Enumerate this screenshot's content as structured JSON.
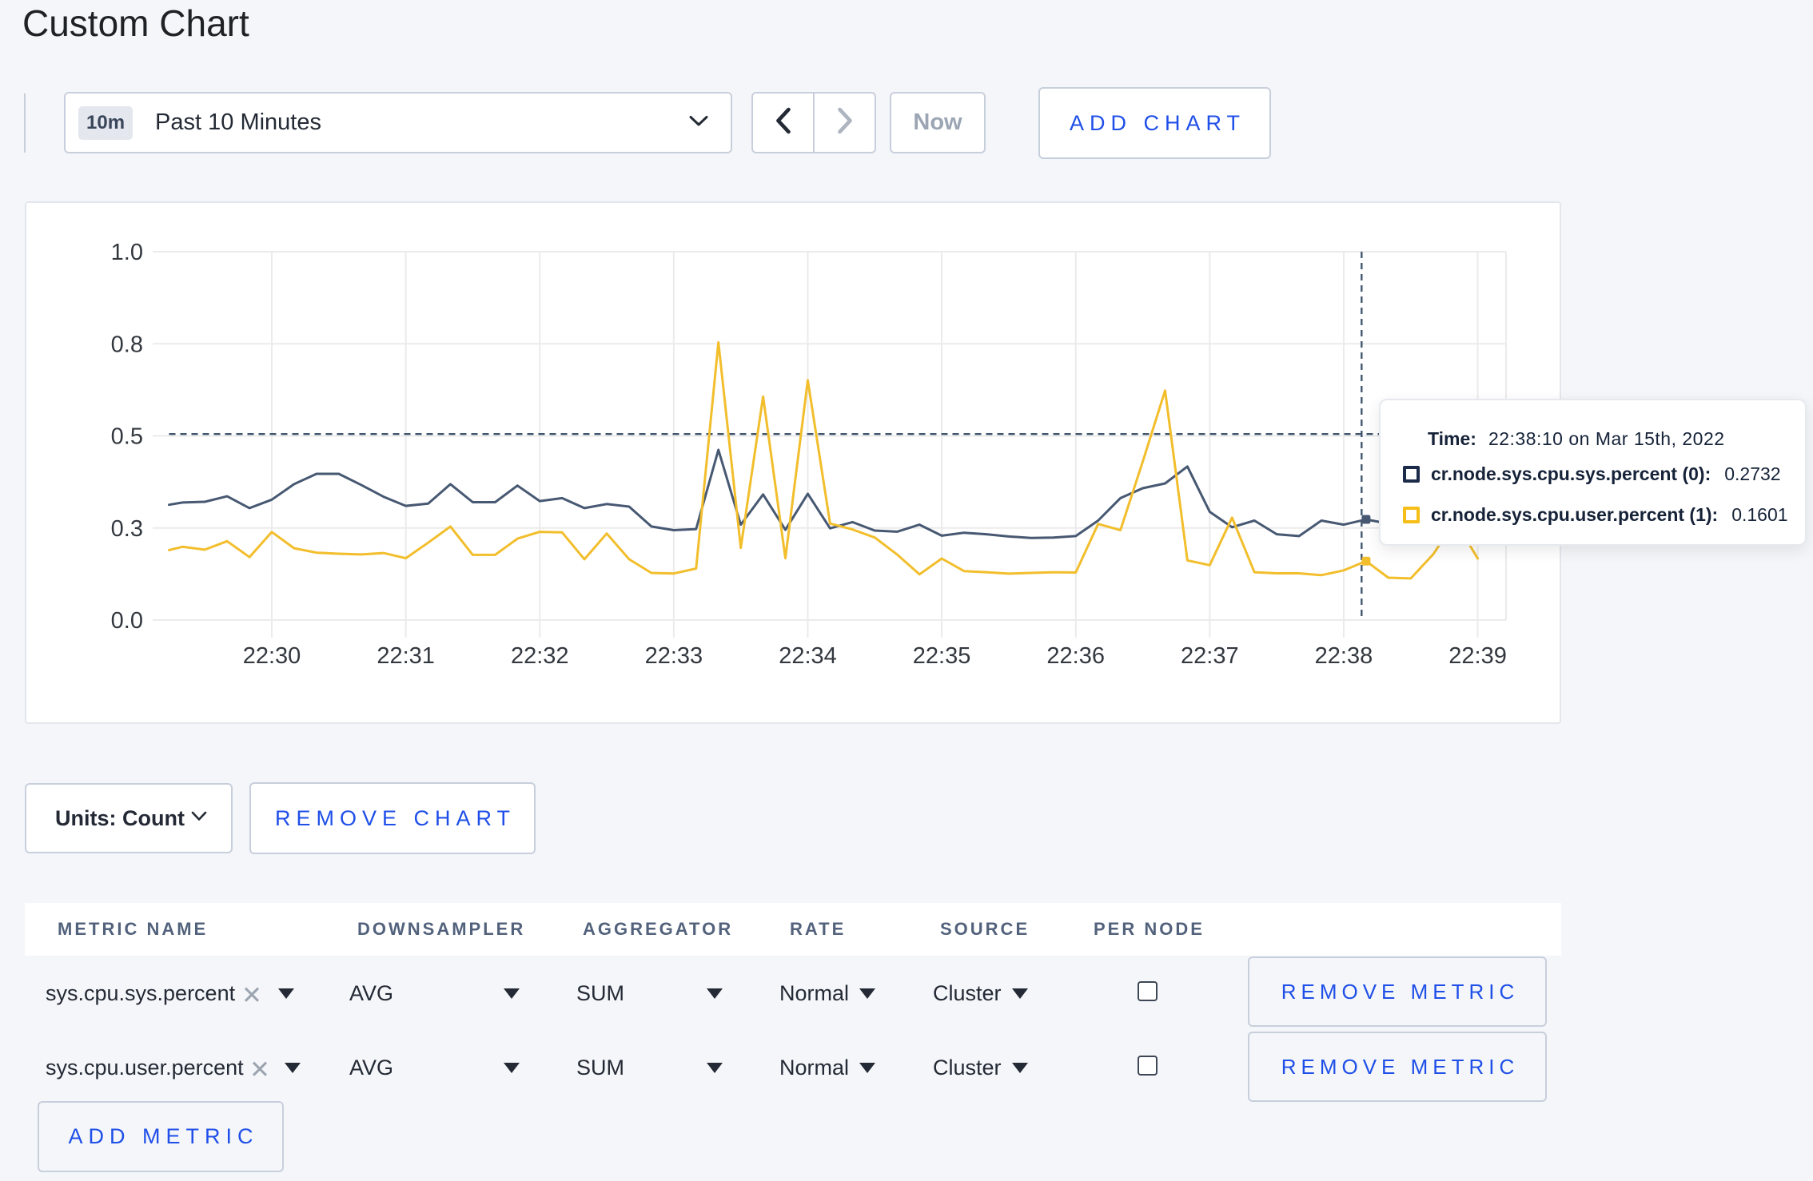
{
  "page": {
    "title": "Custom Chart"
  },
  "controls": {
    "time_window_badge": "10m",
    "time_window_label": "Past 10 Minutes",
    "now_label": "Now",
    "add_chart_label": "ADD CHART"
  },
  "chart_data": {
    "type": "line",
    "title": "",
    "xlabel": "",
    "ylabel": "",
    "x_tick_labels": [
      "22:30",
      "22:31",
      "22:32",
      "22:33",
      "22:34",
      "22:35",
      "22:36",
      "22:37",
      "22:38",
      "22:39"
    ],
    "y_ticks": {
      "values": [
        0,
        0.25,
        0.5,
        0.75,
        1.0
      ],
      "labels": [
        "0.0",
        "0.3",
        "0.5",
        "0.8",
        "1.0"
      ]
    },
    "ylim": [
      0,
      1
    ],
    "grid": true,
    "times": [
      "22:29:14",
      "22:29:20",
      "22:29:30",
      "22:29:40",
      "22:29:50",
      "22:30:00",
      "22:30:10",
      "22:30:20",
      "22:30:30",
      "22:30:40",
      "22:30:50",
      "22:31:00",
      "22:31:10",
      "22:31:20",
      "22:31:30",
      "22:31:40",
      "22:31:50",
      "22:32:00",
      "22:32:10",
      "22:32:20",
      "22:32:30",
      "22:32:40",
      "22:32:50",
      "22:33:00",
      "22:33:10",
      "22:33:20",
      "22:33:30",
      "22:33:40",
      "22:33:50",
      "22:34:00",
      "22:34:10",
      "22:34:20",
      "22:34:30",
      "22:34:40",
      "22:34:50",
      "22:35:00",
      "22:35:10",
      "22:35:20",
      "22:35:30",
      "22:35:40",
      "22:35:50",
      "22:36:00",
      "22:36:10",
      "22:36:20",
      "22:36:30",
      "22:36:40",
      "22:36:50",
      "22:37:00",
      "22:37:10",
      "22:37:20",
      "22:37:30",
      "22:37:40",
      "22:37:50",
      "22:38:00",
      "22:38:10",
      "22:38:20",
      "22:38:30",
      "22:38:40",
      "22:38:50",
      "22:39:00"
    ],
    "series": [
      {
        "name": "cr.node.sys.cpu.sys.percent (0)",
        "color": "#475872",
        "hover_value": "0.2732",
        "values": [
          0.313,
          0.319,
          0.321,
          0.336,
          0.304,
          0.327,
          0.369,
          0.397,
          0.397,
          0.367,
          0.335,
          0.31,
          0.316,
          0.369,
          0.32,
          0.32,
          0.365,
          0.323,
          0.331,
          0.304,
          0.315,
          0.308,
          0.254,
          0.244,
          0.247,
          0.462,
          0.259,
          0.341,
          0.245,
          0.343,
          0.249,
          0.266,
          0.243,
          0.24,
          0.259,
          0.229,
          0.237,
          0.233,
          0.227,
          0.223,
          0.224,
          0.228,
          0.27,
          0.331,
          0.358,
          0.371,
          0.417,
          0.294,
          0.252,
          0.27,
          0.233,
          0.228,
          0.27,
          0.259,
          0.2732,
          0.262,
          0.258,
          0.268,
          0.272,
          0.265
        ]
      },
      {
        "name": "cr.node.sys.cpu.user.percent (1)",
        "color": "#F2BE2C",
        "hover_value": "0.1601",
        "values": [
          0.19,
          0.199,
          0.191,
          0.214,
          0.171,
          0.239,
          0.195,
          0.183,
          0.18,
          0.178,
          0.182,
          0.168,
          0.21,
          0.254,
          0.177,
          0.177,
          0.221,
          0.2395,
          0.238,
          0.165,
          0.235,
          0.165,
          0.128,
          0.1264,
          0.14,
          0.754,
          0.196,
          0.607,
          0.168,
          0.651,
          0.262,
          0.246,
          0.224,
          0.178,
          0.124,
          0.167,
          0.133,
          0.13,
          0.126,
          0.128,
          0.13,
          0.129,
          0.261,
          0.244,
          0.43,
          0.623,
          0.162,
          0.149,
          0.278,
          0.13,
          0.127,
          0.127,
          0.122,
          0.135,
          0.1601,
          0.115,
          0.113,
          0.178,
          0.269,
          0.167
        ]
      }
    ],
    "hover_time": "22:38:10",
    "crosshair": {
      "x_time": "22:38:08",
      "y_value": 0.505
    },
    "legend_position": "tooltip"
  },
  "tooltip": {
    "time_label": "Time:",
    "time_value": "22:38:10 on Mar 15th, 2022"
  },
  "chart_footer": {
    "units_label": "Units: Count",
    "remove_chart_label": "REMOVE CHART"
  },
  "metrics_table": {
    "headers": [
      "METRIC NAME",
      "DOWNSAMPLER",
      "AGGREGATOR",
      "RATE",
      "SOURCE",
      "PER NODE"
    ],
    "rows": [
      {
        "name": "sys.cpu.sys.percent",
        "downsampler": "AVG",
        "aggregator": "SUM",
        "rate": "Normal",
        "source": "Cluster",
        "per_node": false,
        "remove_label": "REMOVE METRIC"
      },
      {
        "name": "sys.cpu.user.percent",
        "downsampler": "AVG",
        "aggregator": "SUM",
        "rate": "Normal",
        "source": "Cluster",
        "per_node": false,
        "remove_label": "REMOVE METRIC"
      }
    ],
    "add_metric_label": "ADD METRIC"
  }
}
